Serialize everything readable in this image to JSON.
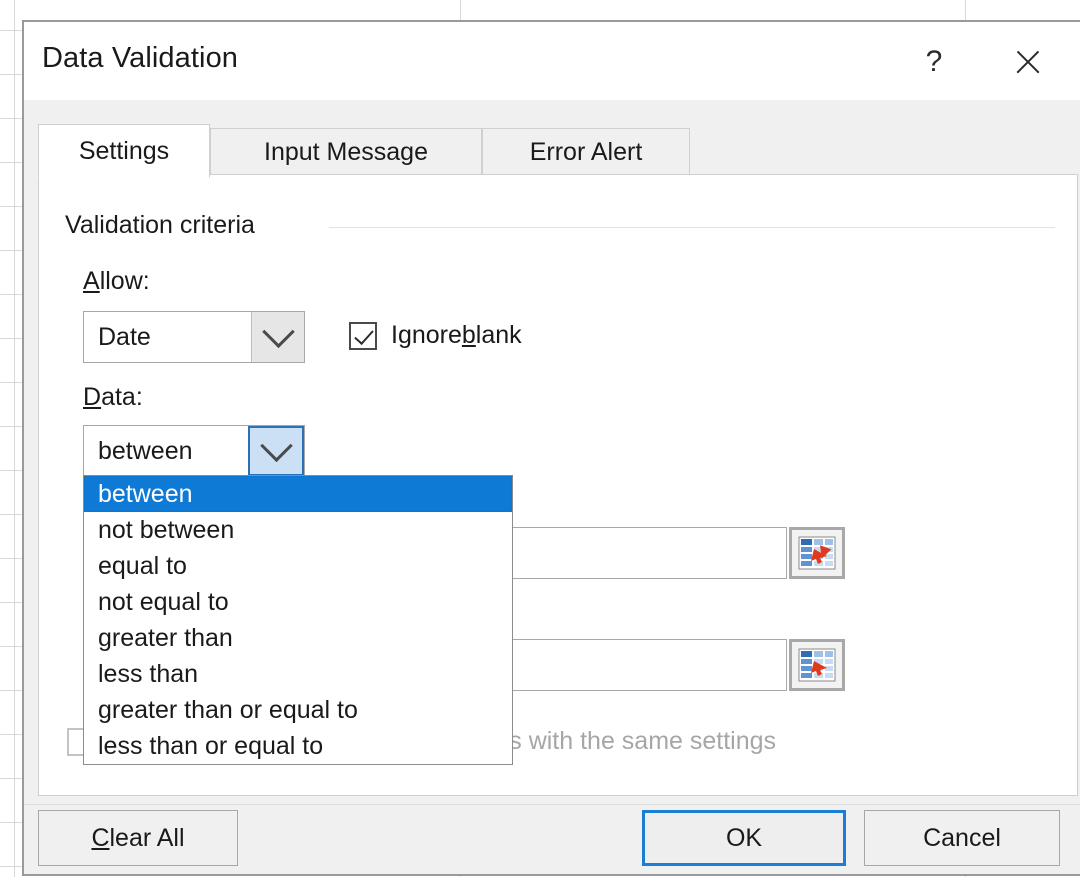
{
  "window": {
    "title": "Data Validation",
    "help_icon": "question-mark-icon",
    "close_icon": "close-icon"
  },
  "tabs": [
    {
      "label": "Settings",
      "active": true
    },
    {
      "label": "Input Message",
      "active": false
    },
    {
      "label": "Error Alert",
      "active": false
    }
  ],
  "settings": {
    "group_title": "Validation criteria",
    "allow": {
      "label_prefix": "",
      "label_accel": "A",
      "label_suffix": "llow:",
      "value": "Date",
      "arrow_icon": "chevron-down-icon"
    },
    "ignore_blank": {
      "text_before": "Ignore ",
      "accel": "b",
      "text_after": "lank",
      "checked": true
    },
    "data": {
      "label_accel": "D",
      "label_suffix": "ata:",
      "value": "between",
      "arrow_icon": "chevron-down-icon",
      "options": [
        "between",
        "not between",
        "equal to",
        "not equal to",
        "greater than",
        "less than",
        "greater than or equal to",
        "less than or equal to"
      ],
      "selected_index": 0
    },
    "start_date": {
      "value": "",
      "picker_icon": "range-select-icon"
    },
    "end_date": {
      "value": "",
      "picker_icon": "range-select-icon"
    },
    "apply_all": {
      "visible_text": "ther cells with the same settings",
      "checked": false,
      "disabled": true
    }
  },
  "footer": {
    "clear_all": {
      "accel": "C",
      "suffix": "lear All"
    },
    "ok": "OK",
    "cancel": "Cancel"
  },
  "colors": {
    "accent_blue": "#0f7ad6",
    "focus_blue": "#1a7fd4",
    "combo_active_bg": "#cce0f5",
    "dialog_bg": "#f0f0f0",
    "disabled_text": "#a6a6a6"
  }
}
